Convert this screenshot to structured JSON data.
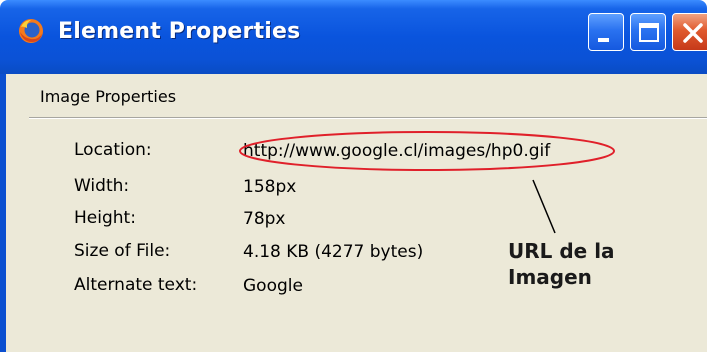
{
  "window": {
    "title": "Element Properties",
    "icon": "firefox-icon",
    "buttons": [
      "minimize-icon",
      "maximize-icon",
      "close-icon"
    ]
  },
  "section": {
    "label": "Image Properties"
  },
  "properties": [
    {
      "label": "Location:",
      "value": "http://www.google.cl/images/hp0.gif"
    },
    {
      "label": "Width:",
      "value": "158px"
    },
    {
      "label": "Height:",
      "value": "78px"
    },
    {
      "label": "Size of File:",
      "value": "4.18 KB (4277 bytes)"
    },
    {
      "label": "Alternate text:",
      "value": "Google"
    }
  ],
  "annotation": {
    "line1": "URL de la",
    "line2": "Imagen",
    "highlight_color": "#e0202a"
  }
}
